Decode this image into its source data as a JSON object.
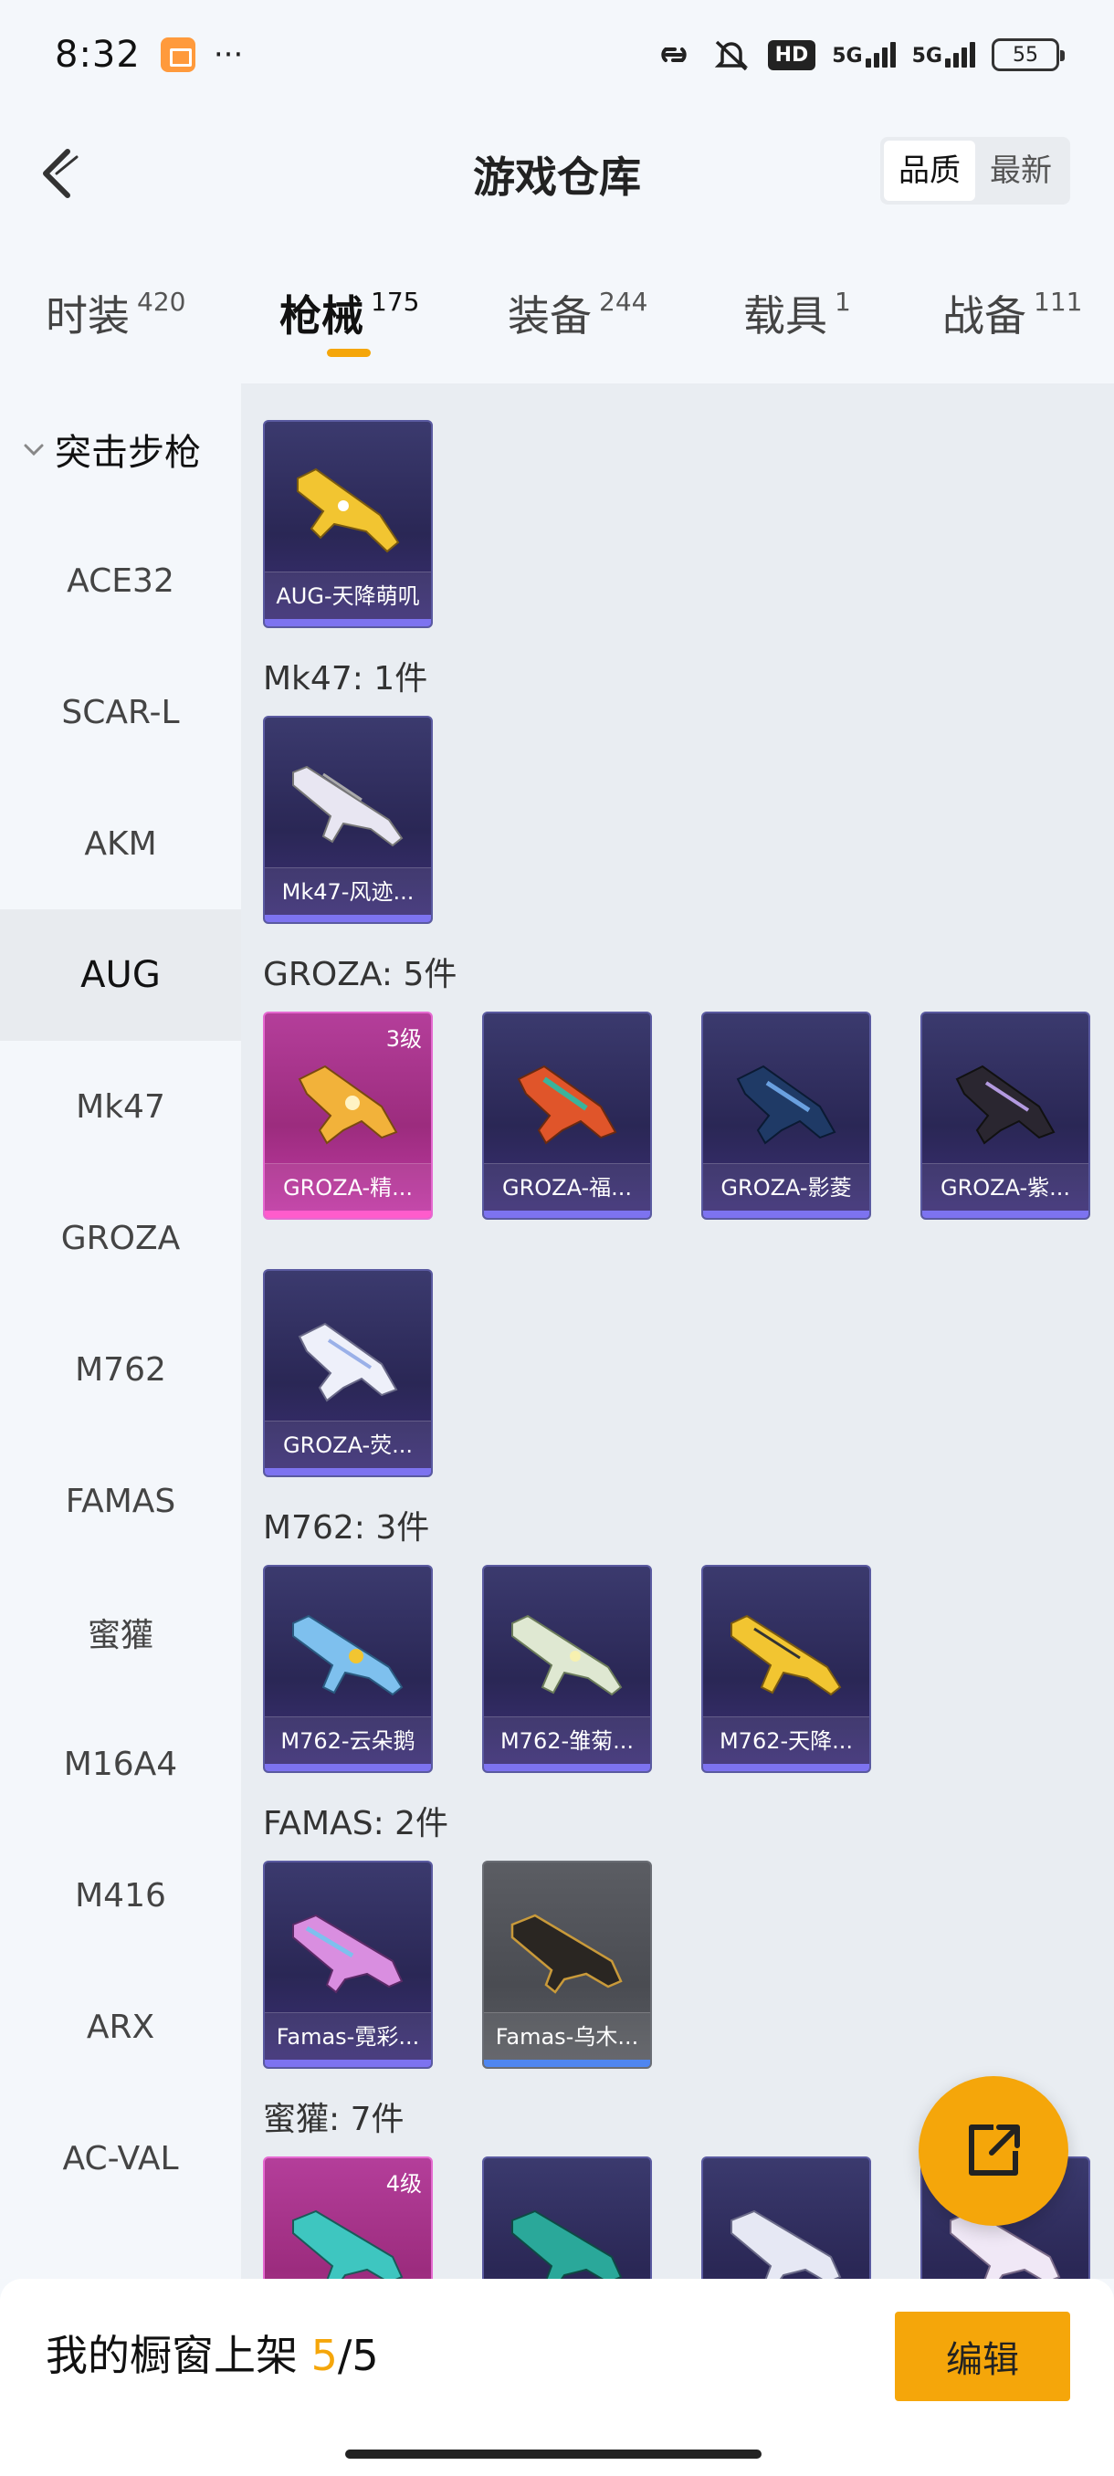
{
  "status_bar": {
    "time": "8:32",
    "battery": "55",
    "network": "5G",
    "hd": "HD"
  },
  "header": {
    "title": "游戏仓库",
    "sort_options": [
      "品质",
      "最新"
    ]
  },
  "tabs": [
    {
      "label": "时装",
      "count": "420"
    },
    {
      "label": "枪械",
      "count": "175"
    },
    {
      "label": "装备",
      "count": "244"
    },
    {
      "label": "载具",
      "count": "1"
    },
    {
      "label": "战备",
      "count": "111"
    }
  ],
  "sidebar": {
    "group": "突击步枪",
    "items": [
      "ACE32",
      "SCAR-L",
      "AKM",
      "AUG",
      "Mk47",
      "GROZA",
      "M762",
      "FAMAS",
      "蜜獾",
      "M16A4",
      "M416",
      "ARX",
      "AC-VAL"
    ],
    "active": "AUG"
  },
  "sections": {
    "aug": {
      "cards": [
        "AUG-天降萌叽"
      ]
    },
    "mk47": {
      "title": "Mk47: 1件",
      "cards": [
        "Mk47-风迹..."
      ]
    },
    "groza": {
      "title": "GROZA: 5件",
      "cards": [
        "GROZA-精...",
        "GROZA-福...",
        "GROZA-影菱",
        "GROZA-紫...",
        "GROZA-荧..."
      ],
      "level_badge": "3级"
    },
    "m762": {
      "title": "M762: 3件",
      "cards": [
        "M762-云朵鹅",
        "M762-雏菊...",
        "M762-天降..."
      ]
    },
    "famas": {
      "title": "FAMAS: 2件",
      "cards": [
        "Famas-霓彩...",
        "Famas-乌木..."
      ]
    },
    "honey": {
      "title": "蜜獾: 7件",
      "level_badge": "4级"
    }
  },
  "bottom": {
    "shelf_label": "我的橱窗上架",
    "shelf_current": "5",
    "shelf_total": "/5",
    "edit_label": "编辑"
  },
  "colors": {
    "accent": "#f5a60a",
    "card_purple": "#2a2755",
    "card_pink": "#b43e9a",
    "card_gray": "#4a4c52"
  }
}
